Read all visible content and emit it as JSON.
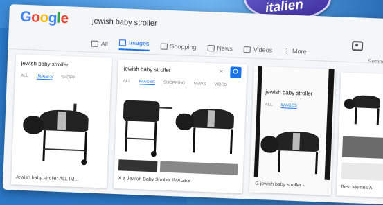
{
  "badge": {
    "text": "italien"
  },
  "logo": {
    "parts": [
      "G",
      "o",
      "o",
      "g",
      "l",
      "e"
    ]
  },
  "search": {
    "query": "jewish baby stroller"
  },
  "tabs": [
    {
      "label": "All",
      "icon": "search-icon"
    },
    {
      "label": "Images",
      "icon": "image-icon"
    },
    {
      "label": "Shopping",
      "icon": "tag-icon"
    },
    {
      "label": "News",
      "icon": "news-icon"
    },
    {
      "label": "Videos",
      "icon": "video-icon"
    },
    {
      "label": "More",
      "icon": "more-icon"
    }
  ],
  "settings_label": "Setting",
  "cards": [
    {
      "query": "jewish baby stroller",
      "tabs": [
        "ALL",
        "IMAGES",
        "SHOPP"
      ],
      "caption": "Jewish baby stroller ALL IM..."
    },
    {
      "query": "jewish baby stroller",
      "tabs": [
        "ALL",
        "IMAGES",
        "SHOPPING",
        "NEWS",
        "VIDEO"
      ],
      "caption": "X a Jewish Baby Stroller IMAGES"
    },
    {
      "query": "jewish baby stroller",
      "tabs": [
        "ALL",
        "IMAGES"
      ],
      "caption": "G jewish baby stroller -"
    },
    {
      "query": "",
      "tabs": [],
      "caption": "Best Memes A"
    }
  ],
  "colors": {
    "google_blue": "#4285f4",
    "accent": "#1a73e8",
    "background": "#2b78c8"
  }
}
